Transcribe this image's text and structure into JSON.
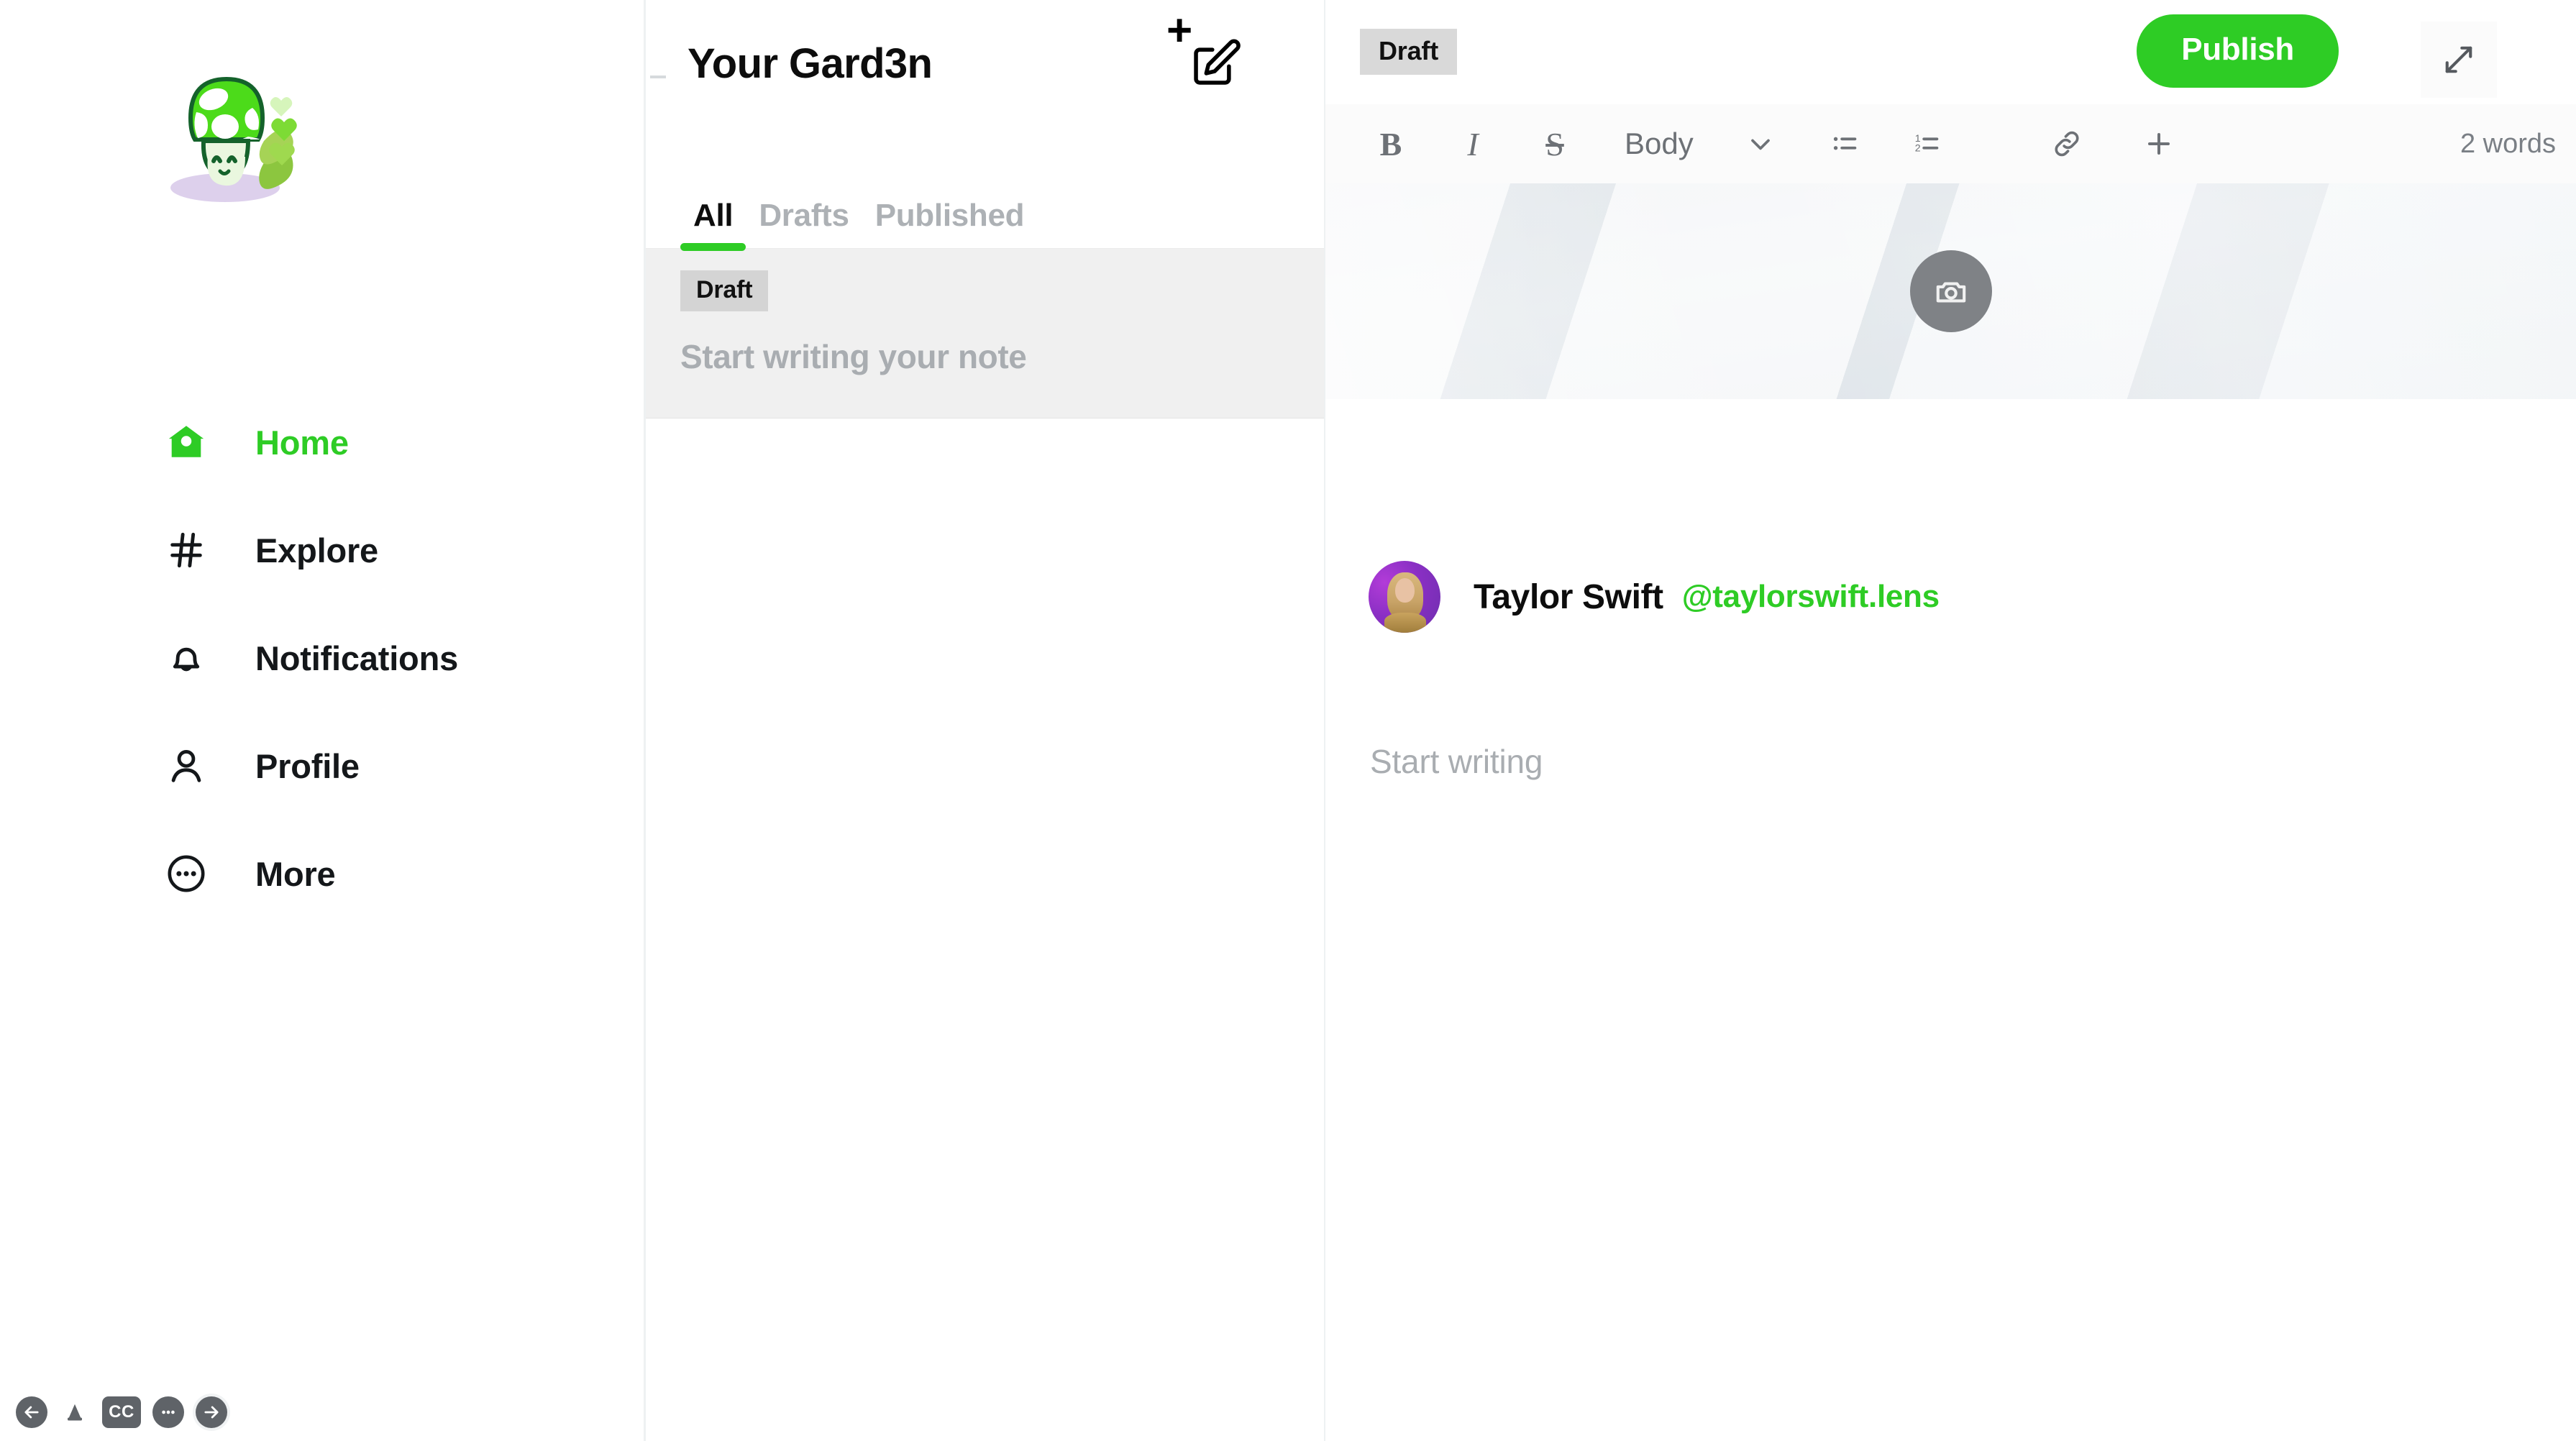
{
  "brand": {
    "accent_green": "#2ecc25",
    "logo_alt": "green-mushroom-mascot"
  },
  "sidebar": {
    "items": [
      {
        "label": "Home",
        "icon": "home-icon",
        "active": true
      },
      {
        "label": "Explore",
        "icon": "hashtag-icon",
        "active": false
      },
      {
        "label": "Notifications",
        "icon": "bell-icon",
        "active": false
      },
      {
        "label": "Profile",
        "icon": "person-icon",
        "active": false
      },
      {
        "label": "More",
        "icon": "ellipsis-circle-icon",
        "active": false
      }
    ],
    "bottom_bar": [
      {
        "icon": "back-arrow-icon"
      },
      {
        "icon": "cone-icon"
      },
      {
        "icon": "closed-captions-icon",
        "label": "CC"
      },
      {
        "icon": "ellipsis-icon"
      },
      {
        "icon": "forward-arrow-icon"
      }
    ]
  },
  "middle": {
    "title": "Your Gard3n",
    "compose_icon": "compose-pencil-icon",
    "compose_plus": "+",
    "tabs": [
      {
        "label": "All",
        "active": true
      },
      {
        "label": "Drafts",
        "active": false
      },
      {
        "label": "Published",
        "active": false
      }
    ],
    "notes": [
      {
        "badge": "Draft",
        "placeholder": "Start writing your note"
      }
    ]
  },
  "editor": {
    "status_badge": "Draft",
    "publish_label": "Publish",
    "expand_icon": "expand-diagonal-icon",
    "toolbar": {
      "bold": "B",
      "italic": "I",
      "strikethrough": "S",
      "block_style": "Body",
      "chevron_icon": "chevron-down-icon",
      "bullet_list_icon": "bullet-list-icon",
      "numbered_list_icon": "numbered-list-icon",
      "link_icon": "link-icon",
      "plus_icon": "plus-icon",
      "word_count": "2 words"
    },
    "cover": {
      "camera_icon": "camera-icon"
    },
    "author": {
      "name": "Taylor Swift",
      "handle": "@taylorswift.lens",
      "avatar_icon": "avatar"
    },
    "body_placeholder": "Start writing"
  }
}
